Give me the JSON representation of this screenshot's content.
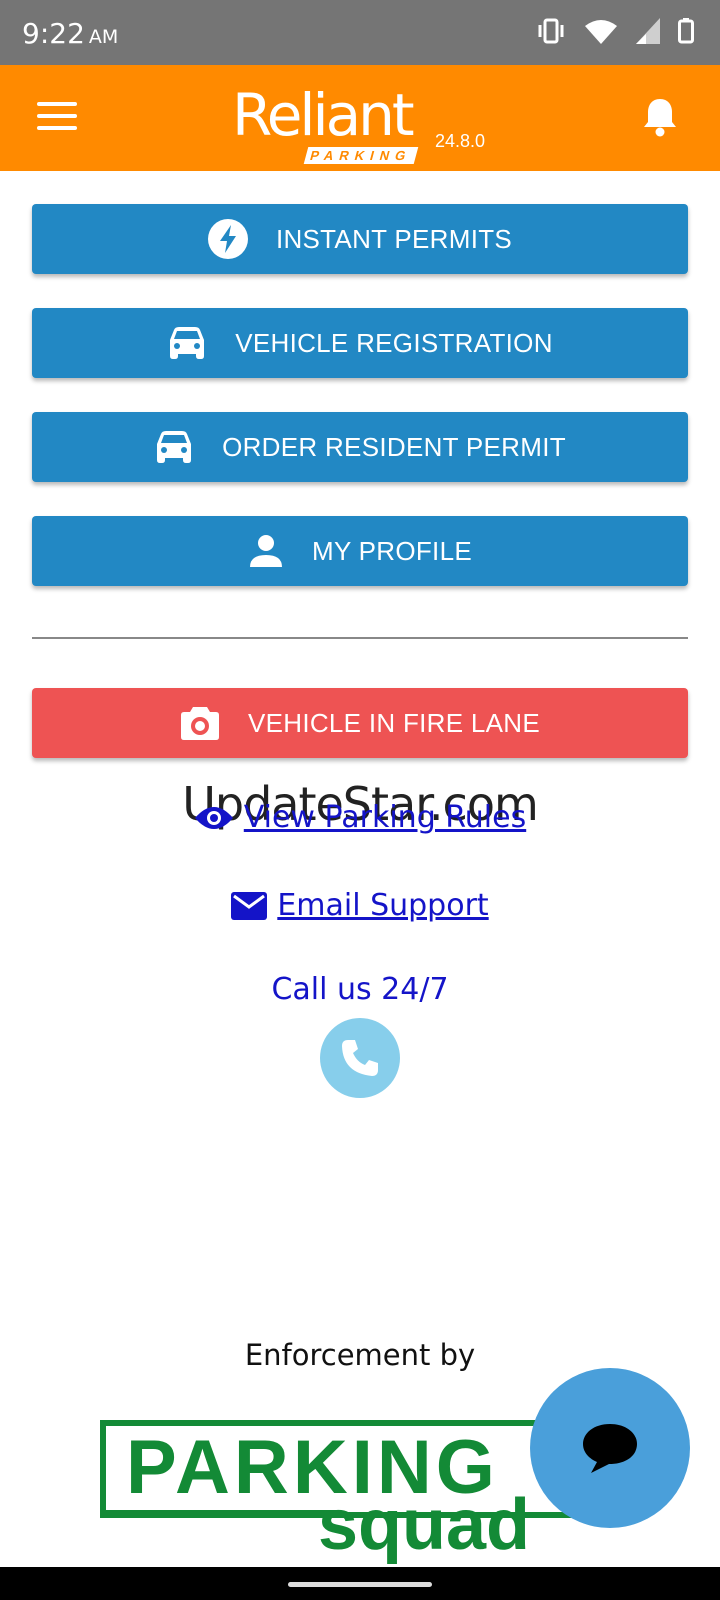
{
  "status_bar": {
    "time": "9:22",
    "ampm": "AM"
  },
  "app_bar": {
    "logo_word": "Reliant",
    "logo_tag": "PARKING",
    "version": "24.8.0"
  },
  "buttons": [
    {
      "label": "INSTANT PERMITS",
      "icon": "bolt-icon"
    },
    {
      "label": "VEHICLE REGISTRATION",
      "icon": "car-icon"
    },
    {
      "label": "ORDER RESIDENT PERMIT",
      "icon": "car-icon"
    },
    {
      "label": "MY PROFILE",
      "icon": "person-icon"
    }
  ],
  "fire_lane": {
    "label": "VEHICLE IN FIRE LANE",
    "icon": "camera-icon",
    "color": "#EE5353"
  },
  "watermark": "UpdateStar.com",
  "links": {
    "parking_rules": "View Parking Rules",
    "email_support": "Email Support"
  },
  "call": {
    "text": "Call us 24/7"
  },
  "enforcement": {
    "text": "Enforcement by",
    "logo_main": "PARKING",
    "logo_sub": "squad"
  },
  "colors": {
    "app_bar": "#FF8A00",
    "primary_button": "#2288C4",
    "link": "#1414C8",
    "logo_green": "#138A36"
  }
}
